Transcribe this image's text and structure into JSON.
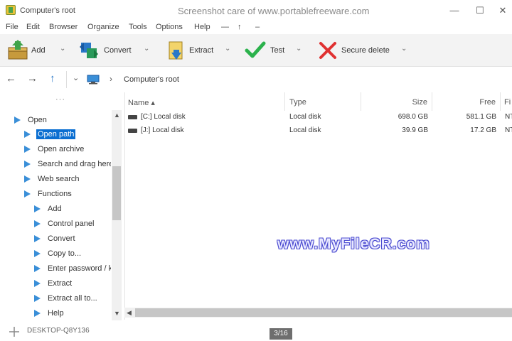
{
  "window": {
    "title": "Computer's root",
    "center_caption": "Screenshot care of www.portablefreeware.com",
    "controls": [
      "—",
      "☐",
      "✕"
    ]
  },
  "menu": [
    "File",
    "Edit",
    "Browser",
    "Organize",
    "Tools",
    "Options",
    "Help",
    "—",
    "↑",
    "–"
  ],
  "toolbar": {
    "add": "Add",
    "convert": "Convert",
    "extract": "Extract",
    "test": "Test",
    "secure_delete": "Secure delete",
    "dropdown_glyph": "⌄"
  },
  "address": {
    "path": "Computer's root",
    "back": "←",
    "forward": "→",
    "up": "↑",
    "history": "⌄",
    "sep": "›"
  },
  "tree": {
    "dots": "···",
    "items": [
      {
        "label": "Open",
        "level": 0
      },
      {
        "label": "Open path",
        "level": 1,
        "selected": true
      },
      {
        "label": "Open archive",
        "level": 1
      },
      {
        "label": "Search and drag here",
        "level": 1
      },
      {
        "label": "Web search",
        "level": 1
      },
      {
        "label": "Functions",
        "level": 1
      },
      {
        "label": "Add",
        "level": 2
      },
      {
        "label": "Control panel",
        "level": 2
      },
      {
        "label": "Convert",
        "level": 2
      },
      {
        "label": "Copy to...",
        "level": 2
      },
      {
        "label": "Enter password / keyfile",
        "level": 2
      },
      {
        "label": "Extract",
        "level": 2
      },
      {
        "label": "Extract all to...",
        "level": 2
      },
      {
        "label": "Help",
        "level": 2
      }
    ],
    "scroll_up": "▲",
    "scroll_down": "▼"
  },
  "list": {
    "columns": [
      "Name ▴",
      "Type",
      "Size",
      "Free",
      "Fi"
    ],
    "rows": [
      {
        "name": "[C:] Local disk",
        "type": "Local disk",
        "size": "698.0 GB",
        "free": "581.1 GB",
        "fs": "NTFS"
      },
      {
        "name": "[J:] Local disk",
        "type": "Local disk",
        "size": "39.9 GB",
        "free": "17.2 GB",
        "fs": "NTFS"
      }
    ],
    "scroll_left": "◀"
  },
  "status": {
    "text": "DESKTOP-Q8Y136",
    "page": "3/16"
  },
  "watermark": "www.MyFileCR.com",
  "colors": {
    "accent": "#0a6ed1",
    "tree_arrow": "#3a8fd8",
    "test_check": "#2bb24c",
    "delete_x": "#e03131"
  }
}
